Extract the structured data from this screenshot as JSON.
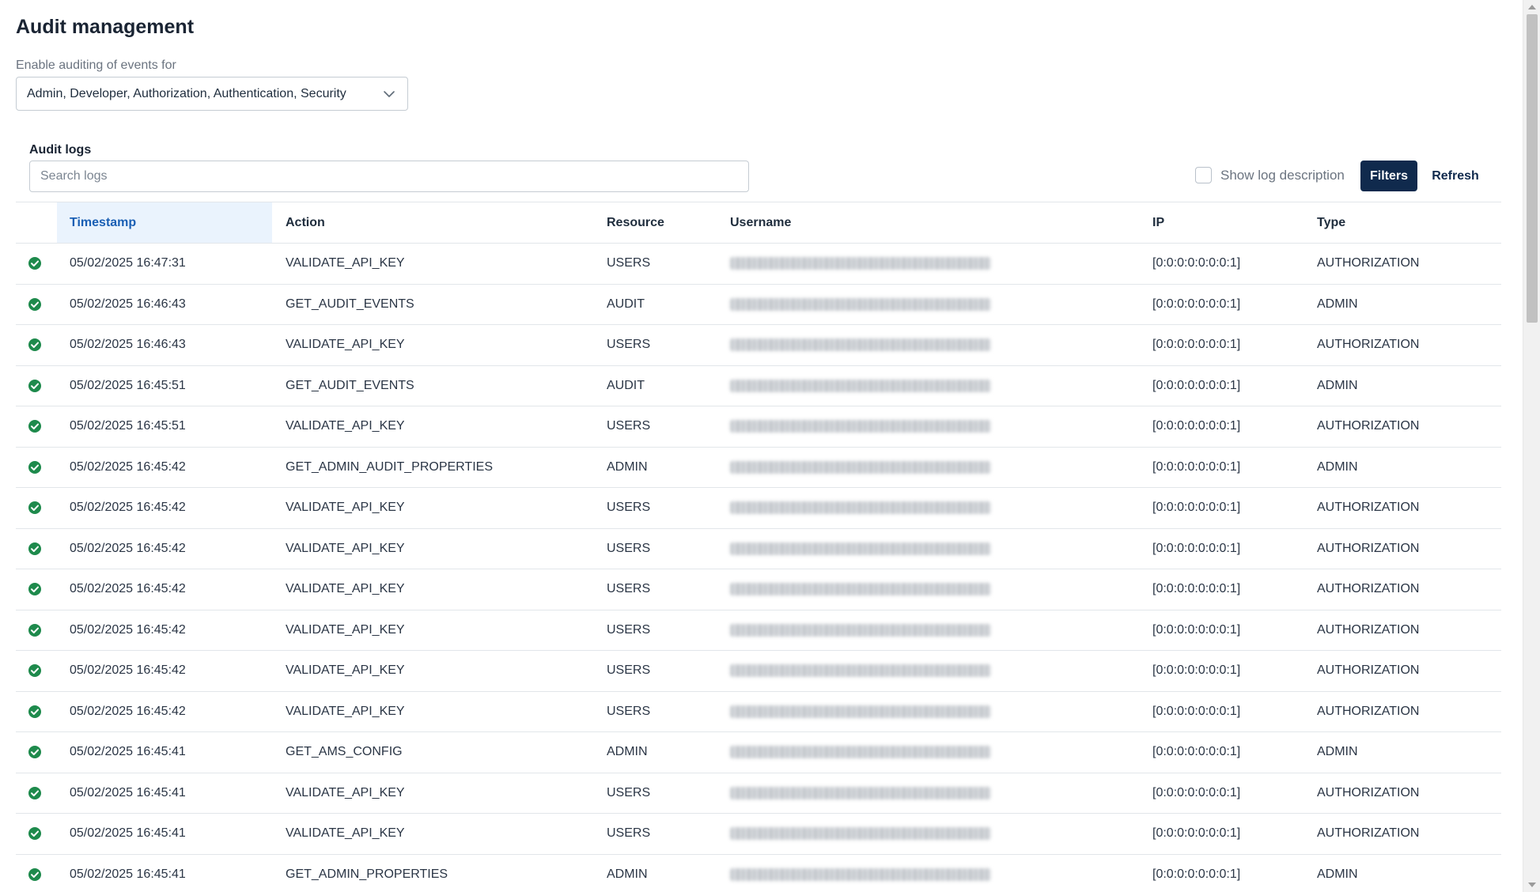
{
  "page": {
    "title": "Audit management"
  },
  "settings": {
    "enable_label": "Enable auditing of events for",
    "scope_value": "Admin, Developer, Authorization, Authentication, Security"
  },
  "logs": {
    "section_label": "Audit logs",
    "search_placeholder": "Search logs",
    "show_description_label": "Show log description",
    "show_description_checked": false,
    "filters_label": "Filters",
    "refresh_label": "Refresh"
  },
  "table": {
    "columns": {
      "timestamp": "Timestamp",
      "action": "Action",
      "resource": "Resource",
      "username": "Username",
      "ip": "IP",
      "type": "Type"
    },
    "sorted_column": "Timestamp",
    "rows": [
      {
        "status": "success",
        "timestamp": "05/02/2025 16:47:31",
        "action": "VALIDATE_API_KEY",
        "resource": "USERS",
        "ip": "[0:0:0:0:0:0:0:1]",
        "type": "AUTHORIZATION"
      },
      {
        "status": "success",
        "timestamp": "05/02/2025 16:46:43",
        "action": "GET_AUDIT_EVENTS",
        "resource": "AUDIT",
        "ip": "[0:0:0:0:0:0:0:1]",
        "type": "ADMIN"
      },
      {
        "status": "success",
        "timestamp": "05/02/2025 16:46:43",
        "action": "VALIDATE_API_KEY",
        "resource": "USERS",
        "ip": "[0:0:0:0:0:0:0:1]",
        "type": "AUTHORIZATION"
      },
      {
        "status": "success",
        "timestamp": "05/02/2025 16:45:51",
        "action": "GET_AUDIT_EVENTS",
        "resource": "AUDIT",
        "ip": "[0:0:0:0:0:0:0:1]",
        "type": "ADMIN"
      },
      {
        "status": "success",
        "timestamp": "05/02/2025 16:45:51",
        "action": "VALIDATE_API_KEY",
        "resource": "USERS",
        "ip": "[0:0:0:0:0:0:0:1]",
        "type": "AUTHORIZATION"
      },
      {
        "status": "success",
        "timestamp": "05/02/2025 16:45:42",
        "action": "GET_ADMIN_AUDIT_PROPERTIES",
        "resource": "ADMIN",
        "ip": "[0:0:0:0:0:0:0:1]",
        "type": "ADMIN"
      },
      {
        "status": "success",
        "timestamp": "05/02/2025 16:45:42",
        "action": "VALIDATE_API_KEY",
        "resource": "USERS",
        "ip": "[0:0:0:0:0:0:0:1]",
        "type": "AUTHORIZATION"
      },
      {
        "status": "success",
        "timestamp": "05/02/2025 16:45:42",
        "action": "VALIDATE_API_KEY",
        "resource": "USERS",
        "ip": "[0:0:0:0:0:0:0:1]",
        "type": "AUTHORIZATION"
      },
      {
        "status": "success",
        "timestamp": "05/02/2025 16:45:42",
        "action": "VALIDATE_API_KEY",
        "resource": "USERS",
        "ip": "[0:0:0:0:0:0:0:1]",
        "type": "AUTHORIZATION"
      },
      {
        "status": "success",
        "timestamp": "05/02/2025 16:45:42",
        "action": "VALIDATE_API_KEY",
        "resource": "USERS",
        "ip": "[0:0:0:0:0:0:0:1]",
        "type": "AUTHORIZATION"
      },
      {
        "status": "success",
        "timestamp": "05/02/2025 16:45:42",
        "action": "VALIDATE_API_KEY",
        "resource": "USERS",
        "ip": "[0:0:0:0:0:0:0:1]",
        "type": "AUTHORIZATION"
      },
      {
        "status": "success",
        "timestamp": "05/02/2025 16:45:42",
        "action": "VALIDATE_API_KEY",
        "resource": "USERS",
        "ip": "[0:0:0:0:0:0:0:1]",
        "type": "AUTHORIZATION"
      },
      {
        "status": "success",
        "timestamp": "05/02/2025 16:45:41",
        "action": "GET_AMS_CONFIG",
        "resource": "ADMIN",
        "ip": "[0:0:0:0:0:0:0:1]",
        "type": "ADMIN"
      },
      {
        "status": "success",
        "timestamp": "05/02/2025 16:45:41",
        "action": "VALIDATE_API_KEY",
        "resource": "USERS",
        "ip": "[0:0:0:0:0:0:0:1]",
        "type": "AUTHORIZATION"
      },
      {
        "status": "success",
        "timestamp": "05/02/2025 16:45:41",
        "action": "VALIDATE_API_KEY",
        "resource": "USERS",
        "ip": "[0:0:0:0:0:0:0:1]",
        "type": "AUTHORIZATION"
      },
      {
        "status": "success",
        "timestamp": "05/02/2025 16:45:41",
        "action": "GET_ADMIN_PROPERTIES",
        "resource": "ADMIN",
        "ip": "[0:0:0:0:0:0:0:1]",
        "type": "ADMIN"
      }
    ]
  },
  "icons": {
    "status_success": "check-circle-icon",
    "dropdown": "chevron-down-icon"
  },
  "colors": {
    "primary": "#102a4d",
    "success": "#1e8a4c",
    "sorted_header_bg": "#eaf3fd",
    "sorted_header_text": "#1a5fb4"
  }
}
